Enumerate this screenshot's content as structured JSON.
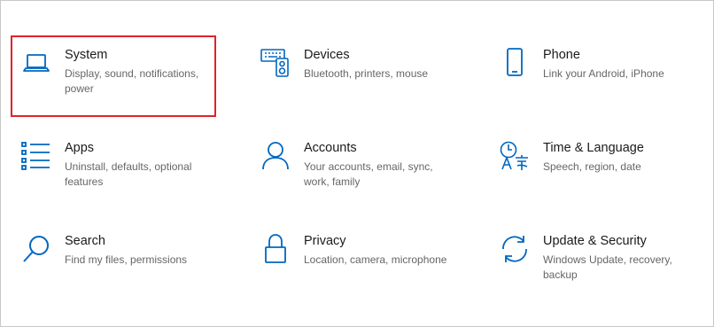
{
  "colors": {
    "accent": "#0067c0",
    "highlight": "#e0232a"
  },
  "tiles": [
    {
      "icon": "laptop-icon",
      "title": "System",
      "desc": "Display, sound, notifications, power"
    },
    {
      "icon": "keyboard-speaker-icon",
      "title": "Devices",
      "desc": "Bluetooth, printers, mouse"
    },
    {
      "icon": "phone-icon",
      "title": "Phone",
      "desc": "Link your Android, iPhone"
    },
    {
      "icon": "apps-list-icon",
      "title": "Apps",
      "desc": "Uninstall, defaults, optional features"
    },
    {
      "icon": "person-icon",
      "title": "Accounts",
      "desc": "Your accounts, email, sync, work, family"
    },
    {
      "icon": "clock-language-icon",
      "title": "Time & Language",
      "desc": "Speech, region, date"
    },
    {
      "icon": "search-icon",
      "title": "Search",
      "desc": "Find my files, permissions"
    },
    {
      "icon": "lock-icon",
      "title": "Privacy",
      "desc": "Location, camera, microphone"
    },
    {
      "icon": "sync-arrows-icon",
      "title": "Update & Security",
      "desc": "Windows Update, recovery, backup"
    }
  ]
}
